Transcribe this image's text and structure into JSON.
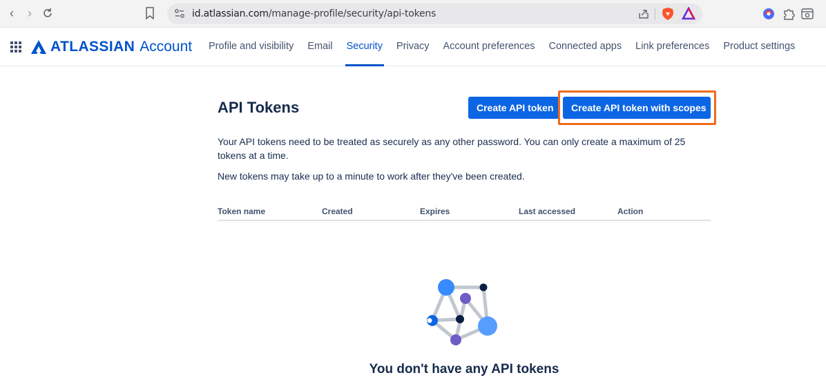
{
  "browser": {
    "url_domain": "id.atlassian.com",
    "url_path": "/manage-profile/security/api-tokens"
  },
  "header": {
    "brand": "ATLASSIAN",
    "product": "Account",
    "nav": [
      {
        "label": "Profile and visibility",
        "active": false
      },
      {
        "label": "Email",
        "active": false
      },
      {
        "label": "Security",
        "active": true
      },
      {
        "label": "Privacy",
        "active": false
      },
      {
        "label": "Account preferences",
        "active": false
      },
      {
        "label": "Connected apps",
        "active": false
      },
      {
        "label": "Link preferences",
        "active": false
      },
      {
        "label": "Product settings",
        "active": false
      }
    ]
  },
  "main": {
    "title": "API Tokens",
    "create_button": "Create API token",
    "create_scopes_button": "Create API token with scopes",
    "description1": "Your API tokens need to be treated as securely as any other password. You can only create a maximum of 25 tokens at a time.",
    "description2": "New tokens may take up to a minute to work after they've been created.",
    "table_headers": [
      "Token name",
      "Created",
      "Expires",
      "Last accessed",
      "Action"
    ],
    "empty_title": "You don't have any API tokens"
  },
  "colors": {
    "brand_blue": "#0052cc",
    "button_blue": "#0c66e4",
    "highlight_orange": "#ef6c1a"
  }
}
